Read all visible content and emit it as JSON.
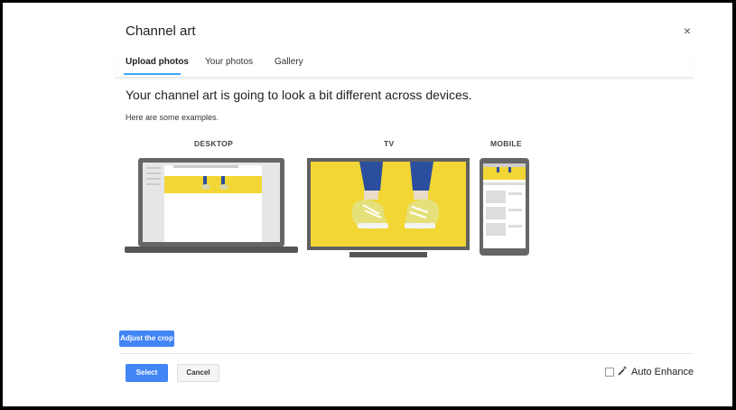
{
  "dialog": {
    "title": "Channel art",
    "close_icon": "×"
  },
  "tabs": [
    {
      "label": "Upload photos"
    },
    {
      "label": "Your photos"
    },
    {
      "label": "Gallery"
    }
  ],
  "content": {
    "headline": "Your channel art is going to look a bit different across devices.",
    "subtext": "Here are some examples.",
    "devices": [
      {
        "label": "DESKTOP"
      },
      {
        "label": "TV"
      },
      {
        "label": "MOBILE"
      }
    ]
  },
  "buttons": {
    "adjust": "Adjust the crop",
    "select": "Select",
    "cancel": "Cancel"
  },
  "auto_enhance": {
    "label": "Auto Enhance",
    "icon": "magic-wand-icon"
  },
  "colors": {
    "accent": "#4285f4",
    "banner_yellow": "#f2d633",
    "device_grey": "#666666"
  }
}
